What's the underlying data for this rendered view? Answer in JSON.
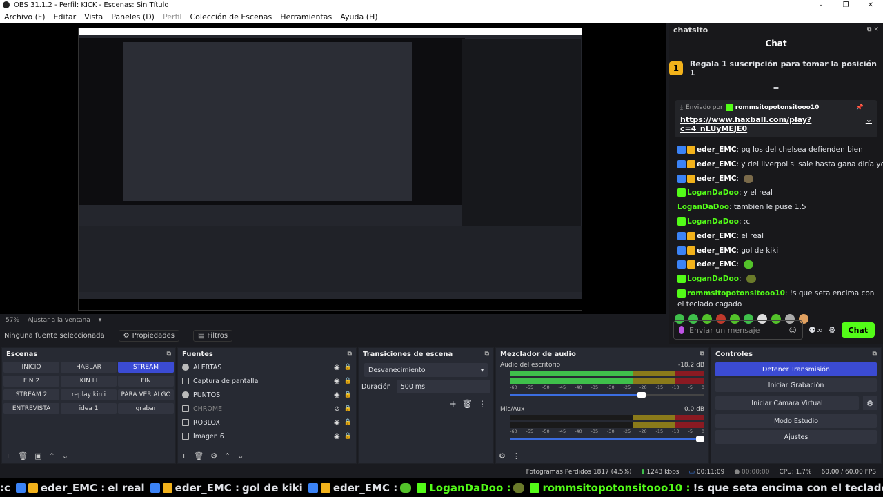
{
  "window": {
    "title": "OBS 31.1.2 - Perfil: KICK - Escenas: Sin Título",
    "controls": [
      "–",
      "❐",
      "✕"
    ]
  },
  "menu": [
    "Archivo (F)",
    "Editar",
    "Vista",
    "Paneles (D)",
    "Perfil",
    "Colección de Escenas",
    "Herramientas",
    "Ayuda (H)"
  ],
  "zoom": {
    "value": "57%",
    "fit_label": "Ajustar a la ventana"
  },
  "source_bar": {
    "selected": "Ninguna fuente seleccionada",
    "properties": "Propiedades",
    "filters": "Filtros"
  },
  "chat": {
    "dock_title": "chatsito",
    "title": "Chat",
    "gift_banner": {
      "badge": "1",
      "text": "Regala 1 suscripción para tomar la posición 1"
    },
    "pinned": {
      "sent_by": "Enviado por",
      "user": "rommsitopotonsitooo10",
      "link": "https://www.haxball.com/play?c=4_nLUyMEJE0"
    },
    "messages": [
      {
        "user": "eder_EMC",
        "text": "pq los del chelsea defienden bien",
        "color": "#ffffff",
        "badges": [
          "blue",
          "gold"
        ]
      },
      {
        "user": "eder_EMC",
        "text": "y del liverpol si sale hasta gana diría yo",
        "color": "#ffffff",
        "badges": [
          "blue",
          "gold"
        ]
      },
      {
        "user": "eder_EMC",
        "text": "",
        "emote": "#7a6a4a",
        "color": "#ffffff",
        "badges": [
          "blue",
          "gold"
        ]
      },
      {
        "user": "LoganDaDoo",
        "text": "y el real",
        "color": "#53fc18",
        "badges": [
          "green"
        ]
      },
      {
        "user": "LoganDaDoo",
        "text": "tambien le puse 1.5",
        "color": "#53fc18",
        "badges": []
      },
      {
        "user": "LoganDaDoo",
        "text": ":c",
        "color": "#53fc18",
        "badges": [
          "green"
        ]
      },
      {
        "user": "eder_EMC",
        "text": "el real",
        "color": "#ffffff",
        "badges": [
          "blue",
          "gold"
        ]
      },
      {
        "user": "eder_EMC",
        "text": "gol de kiki",
        "color": "#ffffff",
        "badges": [
          "blue",
          "gold"
        ]
      },
      {
        "user": "eder_EMC",
        "text": "",
        "emote": "#53c22a",
        "color": "#ffffff",
        "badges": [
          "blue",
          "gold"
        ]
      },
      {
        "user": "LoganDaDoo",
        "text": "",
        "emote": "#6a7a2a",
        "color": "#53fc18",
        "badges": [
          "green"
        ]
      }
    ],
    "last_message": {
      "user": "rommsitopotonsitooo10",
      "text": "!s que seta encima con el teclado cagado"
    },
    "emote_colors": [
      "#3fc04b",
      "#3fc04b",
      "#53c22a",
      "#c0392b",
      "#53c22a",
      "#3fc04b",
      "#dddddd",
      "#53c22a",
      "#aaaaaa",
      "#e0a060"
    ],
    "input_placeholder": "Enviar un mensaje",
    "send_label": "Chat"
  },
  "scenes": {
    "title": "Escenas",
    "items": [
      "INICIO",
      "HABLAR",
      "STREAM",
      "FIN 2",
      "KIN LI",
      "FIN",
      "STREAM 2",
      "replay kinli",
      "PARA VER ALGO",
      "ENTREVISTA",
      "idea 1",
      "grabar"
    ],
    "active": "STREAM"
  },
  "sources": {
    "title": "Fuentes",
    "items": [
      {
        "name": "ALERTAS",
        "icon": "globe",
        "visible": true
      },
      {
        "name": "Captura de pantalla",
        "icon": "monitor",
        "visible": true
      },
      {
        "name": "PUNTOS",
        "icon": "globe",
        "visible": true
      },
      {
        "name": "CHROME",
        "icon": "window",
        "visible": false
      },
      {
        "name": "ROBLOX",
        "icon": "window",
        "visible": true
      },
      {
        "name": "Imagen 6",
        "icon": "image",
        "visible": true
      }
    ]
  },
  "transitions": {
    "title": "Transiciones de escena",
    "selected": "Desvanecimiento",
    "duration_label": "Duración",
    "duration_value": "500 ms"
  },
  "mixer": {
    "title": "Mezclador de audio",
    "channels": [
      {
        "name": "Audio del escritorio",
        "db": "-18.2 dB",
        "level": 0.72,
        "volume": 0.7
      },
      {
        "name": "Mic/Aux",
        "db": "0.0 dB",
        "level": 0.0,
        "volume": 1.0
      }
    ],
    "ticks": [
      "-60",
      "-55",
      "-50",
      "-45",
      "-40",
      "-35",
      "-30",
      "-25",
      "-20",
      "-15",
      "-10",
      "-5",
      "0"
    ]
  },
  "controls": {
    "title": "Controles",
    "stop_stream": "Detener Transmisión",
    "start_recording": "Iniciar Grabación",
    "start_virtual_cam": "Iniciar Cámara Virtual",
    "studio_mode": "Modo Estudio",
    "settings": "Ajustes"
  },
  "status": {
    "dropped_frames": "Fotogramas Perdidos 1817 (4.5%)",
    "bitrate": "1243 kbps",
    "live_time": "00:11:09",
    "rec_time": "00:00:00",
    "cpu": "CPU: 1.7%",
    "fps": "60.00 / 60.00 FPS"
  },
  "ticker": [
    {
      "user": "",
      "text": ":c",
      "emote": ""
    },
    {
      "user": "eder_EMC",
      "text": "el real",
      "emote": ""
    },
    {
      "user": "eder_EMC",
      "text": "gol de kiki",
      "emote": ""
    },
    {
      "user": "eder_EMC",
      "text": "",
      "emote": "#53c22a"
    },
    {
      "user": "LoganDaDoo",
      "text": "",
      "emote": "#6a7a2a"
    },
    {
      "user": "rommsitopotonsitooo10",
      "text": "!s que seta encima con el teclado cagado",
      "emote": ""
    }
  ]
}
